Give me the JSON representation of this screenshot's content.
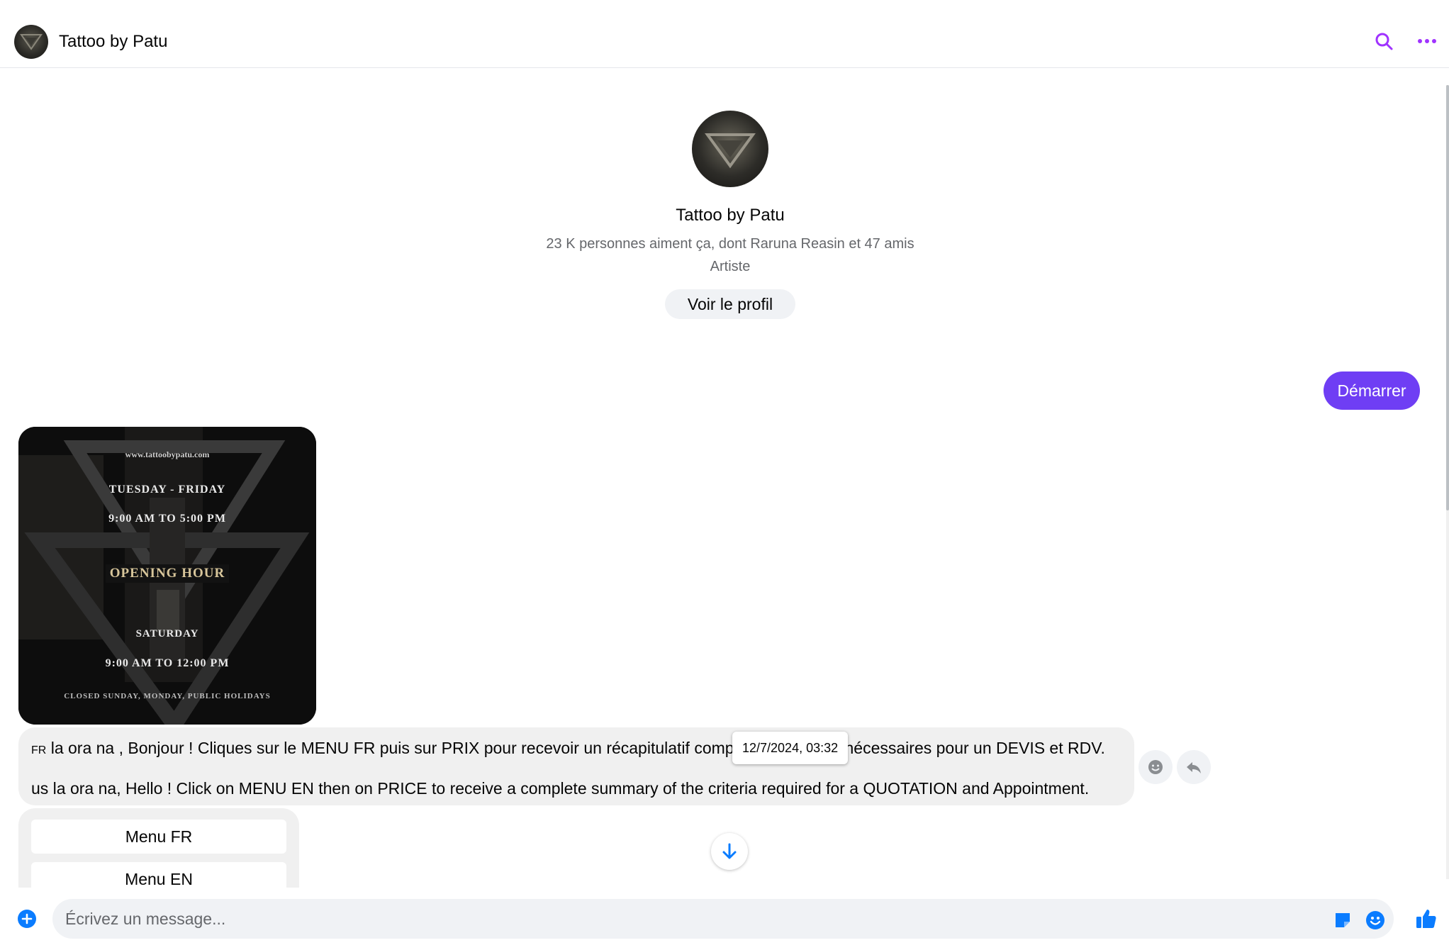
{
  "header": {
    "title": "Tattoo by Patu",
    "icons": [
      "search-icon",
      "more-options-icon"
    ]
  },
  "profile": {
    "name": "Tattoo by Patu",
    "meta": "23 K personnes aiment ça, dont Raruna Reasin et 47 amis",
    "category": "Artiste",
    "view_profile_label": "Voir le profil"
  },
  "outgoing": {
    "start_label": "Démarrer"
  },
  "image_card": {
    "url": "www.tattoobypatu.com",
    "days1": "TUESDAY - FRIDAY",
    "hours1": "9:00 AM TO 5:00 PM",
    "opening": "OPENING HOUR",
    "days2": "SATURDAY",
    "hours2": "9:00 AM TO 12:00 PM",
    "closed": "CLOSED SUNDAY, MONDAY, PUBLIC HOLIDAYS"
  },
  "message": {
    "line1_prefix": "FR",
    "line1": " la ora na , Bonjour ! Cliques sur le MENU FR puis sur PRIX pour recevoir un récapitulatif complet des critères nécessaires pour un DEVIS et RDV.",
    "line2": "us la ora na, Hello ! Click on MENU EN then on PRICE to receive a complete summary of the criteria required for a QUOTATION and Appointment.",
    "timestamp": "12/7/2024, 03:32"
  },
  "quick_menu": {
    "fr_label": "Menu FR",
    "en_label": "Menu EN"
  },
  "composer": {
    "placeholder": "Écrivez un message..."
  },
  "colors": {
    "accent_purple": "#6f3ef4",
    "header_icon": "#a033ff",
    "messenger_blue": "#0a7cff",
    "bubble_gray": "#f0f0f0"
  }
}
